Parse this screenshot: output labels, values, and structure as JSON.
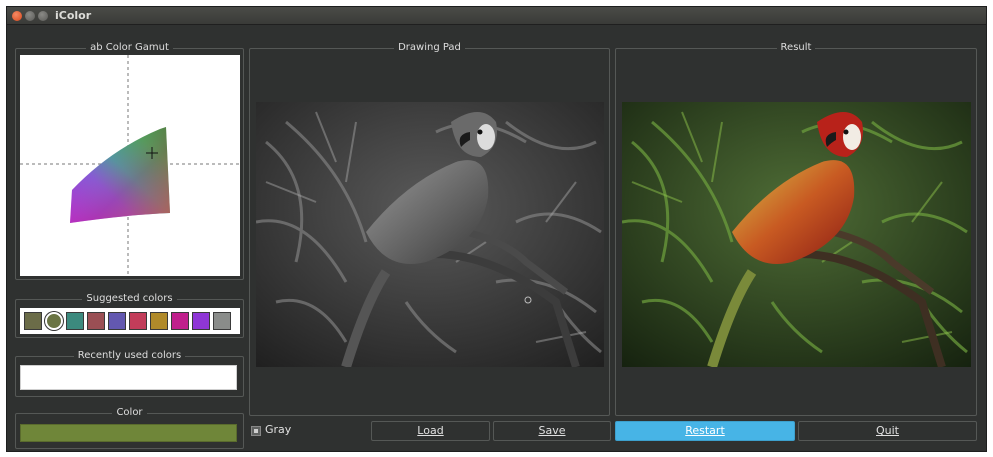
{
  "window": {
    "title": "iColor"
  },
  "panels": {
    "gamut": "ab Color Gamut",
    "suggested": "Suggested colors",
    "recent": "Recently used colors",
    "color": "Color",
    "drawing": "Drawing Pad",
    "result": "Result"
  },
  "suggested_colors": [
    "#6b6c48",
    "#6a7443",
    "#3c8a7e",
    "#9a4f54",
    "#6358b0",
    "#c23d5a",
    "#b08a2a",
    "#c01f8c",
    "#8f36d6",
    "#8a8c8a"
  ],
  "current_color": "#6f8639",
  "controls": {
    "gray_label": "Gray",
    "gray_checked": true,
    "load": "Load",
    "save": "Save",
    "restart": "Restart",
    "quit": "Quit"
  },
  "icons": [
    "close-icon",
    "minimize-icon",
    "maximize-icon",
    "crosshair-icon"
  ]
}
